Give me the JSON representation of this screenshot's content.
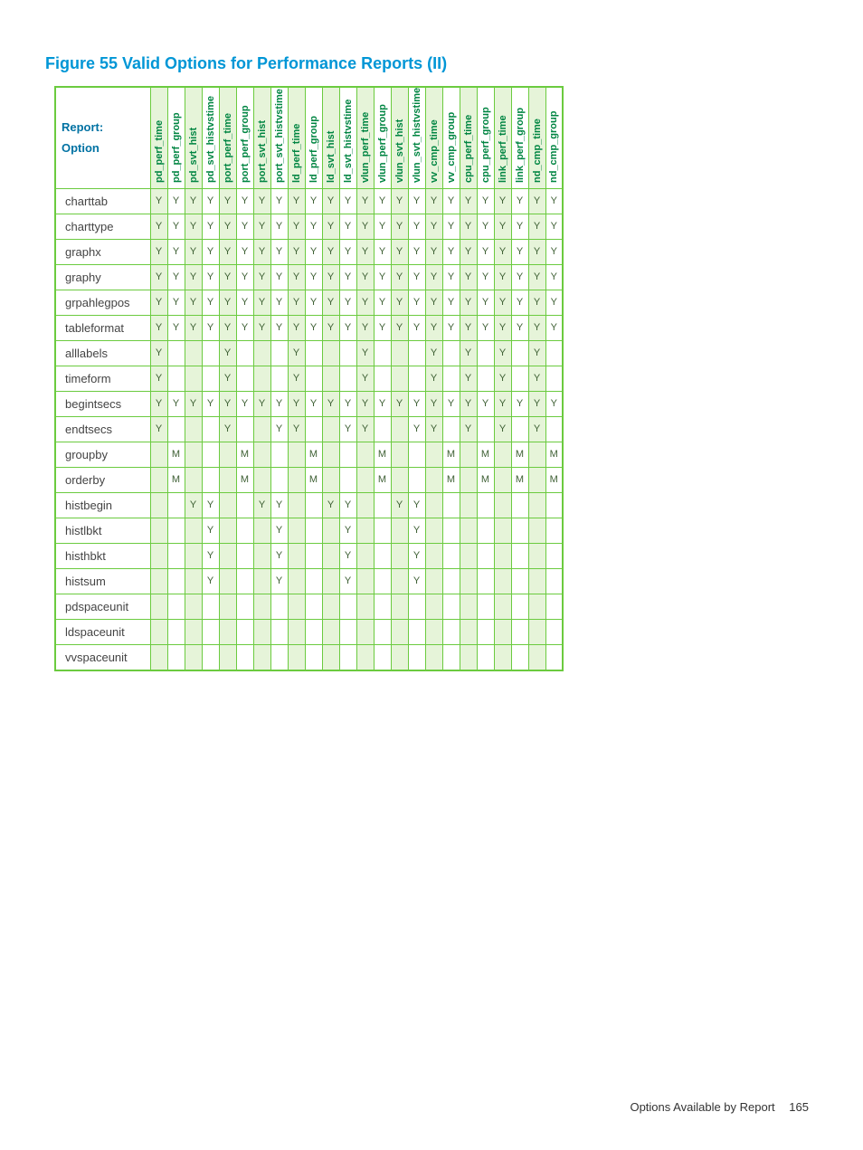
{
  "title": "Figure 55 Valid Options for Performance Reports (II)",
  "corner_label_line1": "Report:",
  "corner_label_line2": "Option",
  "footer_text": "Options Available by Report",
  "page_number": "165",
  "chart_data": {
    "type": "table",
    "columns": [
      "pd_perf_time",
      "pd_perf_group",
      "pd_svt_hist",
      "pd_svt_histvstime",
      "port_perf_time",
      "port_perf_group",
      "port_svt_hist",
      "port_svt_histvstime",
      "ld_perf_time",
      "ld_perf_group",
      "ld_svt_hist",
      "ld_svt_histvstime",
      "vlun_perf_time",
      "vlun_perf_group",
      "vlun_svt_hist",
      "vlun_svt_histvstime",
      "vv_cmp_time",
      "vv_cmp_group",
      "cpu_perf_time",
      "cpu_perf_group",
      "link_perf_time",
      "link_perf_group",
      "nd_cmp_time",
      "nd_cmp_group"
    ],
    "rows": [
      {
        "name": "charttab",
        "cells": [
          "Y",
          "Y",
          "Y",
          "Y",
          "Y",
          "Y",
          "Y",
          "Y",
          "Y",
          "Y",
          "Y",
          "Y",
          "Y",
          "Y",
          "Y",
          "Y",
          "Y",
          "Y",
          "Y",
          "Y",
          "Y",
          "Y",
          "Y",
          "Y"
        ]
      },
      {
        "name": "charttype",
        "cells": [
          "Y",
          "Y",
          "Y",
          "Y",
          "Y",
          "Y",
          "Y",
          "Y",
          "Y",
          "Y",
          "Y",
          "Y",
          "Y",
          "Y",
          "Y",
          "Y",
          "Y",
          "Y",
          "Y",
          "Y",
          "Y",
          "Y",
          "Y",
          "Y"
        ]
      },
      {
        "name": "graphx",
        "cells": [
          "Y",
          "Y",
          "Y",
          "Y",
          "Y",
          "Y",
          "Y",
          "Y",
          "Y",
          "Y",
          "Y",
          "Y",
          "Y",
          "Y",
          "Y",
          "Y",
          "Y",
          "Y",
          "Y",
          "Y",
          "Y",
          "Y",
          "Y",
          "Y"
        ]
      },
      {
        "name": "graphy",
        "cells": [
          "Y",
          "Y",
          "Y",
          "Y",
          "Y",
          "Y",
          "Y",
          "Y",
          "Y",
          "Y",
          "Y",
          "Y",
          "Y",
          "Y",
          "Y",
          "Y",
          "Y",
          "Y",
          "Y",
          "Y",
          "Y",
          "Y",
          "Y",
          "Y"
        ]
      },
      {
        "name": "grpahlegpos",
        "cells": [
          "Y",
          "Y",
          "Y",
          "Y",
          "Y",
          "Y",
          "Y",
          "Y",
          "Y",
          "Y",
          "Y",
          "Y",
          "Y",
          "Y",
          "Y",
          "Y",
          "Y",
          "Y",
          "Y",
          "Y",
          "Y",
          "Y",
          "Y",
          "Y"
        ]
      },
      {
        "name": "tableformat",
        "cells": [
          "Y",
          "Y",
          "Y",
          "Y",
          "Y",
          "Y",
          "Y",
          "Y",
          "Y",
          "Y",
          "Y",
          "Y",
          "Y",
          "Y",
          "Y",
          "Y",
          "Y",
          "Y",
          "Y",
          "Y",
          "Y",
          "Y",
          "Y",
          "Y"
        ]
      },
      {
        "name": "alllabels",
        "cells": [
          "Y",
          "",
          "",
          "",
          "Y",
          "",
          "",
          "",
          "Y",
          "",
          "",
          "",
          "Y",
          "",
          "",
          "",
          "Y",
          "",
          "Y",
          "",
          "Y",
          "",
          "Y",
          ""
        ]
      },
      {
        "name": "timeform",
        "cells": [
          "Y",
          "",
          "",
          "",
          "Y",
          "",
          "",
          "",
          "Y",
          "",
          "",
          "",
          "Y",
          "",
          "",
          "",
          "Y",
          "",
          "Y",
          "",
          "Y",
          "",
          "Y",
          ""
        ]
      },
      {
        "name": "begintsecs",
        "cells": [
          "Y",
          "Y",
          "Y",
          "Y",
          "Y",
          "Y",
          "Y",
          "Y",
          "Y",
          "Y",
          "Y",
          "Y",
          "Y",
          "Y",
          "Y",
          "Y",
          "Y",
          "Y",
          "Y",
          "Y",
          "Y",
          "Y",
          "Y",
          "Y"
        ]
      },
      {
        "name": "endtsecs",
        "cells": [
          "Y",
          "",
          "",
          "",
          "Y",
          "",
          "",
          "Y",
          "Y",
          "",
          "",
          "Y",
          "Y",
          "",
          "",
          "Y",
          "Y",
          "",
          "Y",
          "",
          "Y",
          "",
          "Y",
          ""
        ]
      },
      {
        "name": "groupby",
        "cells": [
          "",
          "M",
          "",
          "",
          "",
          "M",
          "",
          "",
          "",
          "M",
          "",
          "",
          "",
          "M",
          "",
          "",
          "",
          "M",
          "",
          "M",
          "",
          "M",
          "",
          "M"
        ]
      },
      {
        "name": "orderby",
        "cells": [
          "",
          "M",
          "",
          "",
          "",
          "M",
          "",
          "",
          "",
          "M",
          "",
          "",
          "",
          "M",
          "",
          "",
          "",
          "M",
          "",
          "M",
          "",
          "M",
          "",
          "M"
        ]
      },
      {
        "name": "histbegin",
        "cells": [
          "",
          "",
          "Y",
          "Y",
          "",
          "",
          "Y",
          "Y",
          "",
          "",
          "Y",
          "Y",
          "",
          "",
          "Y",
          "Y",
          "",
          "",
          "",
          "",
          "",
          "",
          "",
          ""
        ]
      },
      {
        "name": "histlbkt",
        "cells": [
          "",
          "",
          "",
          "Y",
          "",
          "",
          "",
          "Y",
          "",
          "",
          "",
          "Y",
          "",
          "",
          "",
          "Y",
          "",
          "",
          "",
          "",
          "",
          "",
          "",
          ""
        ]
      },
      {
        "name": "histhbkt",
        "cells": [
          "",
          "",
          "",
          "Y",
          "",
          "",
          "",
          "Y",
          "",
          "",
          "",
          "Y",
          "",
          "",
          "",
          "Y",
          "",
          "",
          "",
          "",
          "",
          "",
          "",
          ""
        ]
      },
      {
        "name": "histsum",
        "cells": [
          "",
          "",
          "",
          "Y",
          "",
          "",
          "",
          "Y",
          "",
          "",
          "",
          "Y",
          "",
          "",
          "",
          "Y",
          "",
          "",
          "",
          "",
          "",
          "",
          "",
          ""
        ]
      },
      {
        "name": "pdspaceunit",
        "cells": [
          "",
          "",
          "",
          "",
          "",
          "",
          "",
          "",
          "",
          "",
          "",
          "",
          "",
          "",
          "",
          "",
          "",
          "",
          "",
          "",
          "",
          "",
          "",
          ""
        ]
      },
      {
        "name": "ldspaceunit",
        "cells": [
          "",
          "",
          "",
          "",
          "",
          "",
          "",
          "",
          "",
          "",
          "",
          "",
          "",
          "",
          "",
          "",
          "",
          "",
          "",
          "",
          "",
          "",
          "",
          ""
        ]
      },
      {
        "name": "vvspaceunit",
        "cells": [
          "",
          "",
          "",
          "",
          "",
          "",
          "",
          "",
          "",
          "",
          "",
          "",
          "",
          "",
          "",
          "",
          "",
          "",
          "",
          "",
          "",
          "",
          "",
          ""
        ]
      }
    ]
  }
}
